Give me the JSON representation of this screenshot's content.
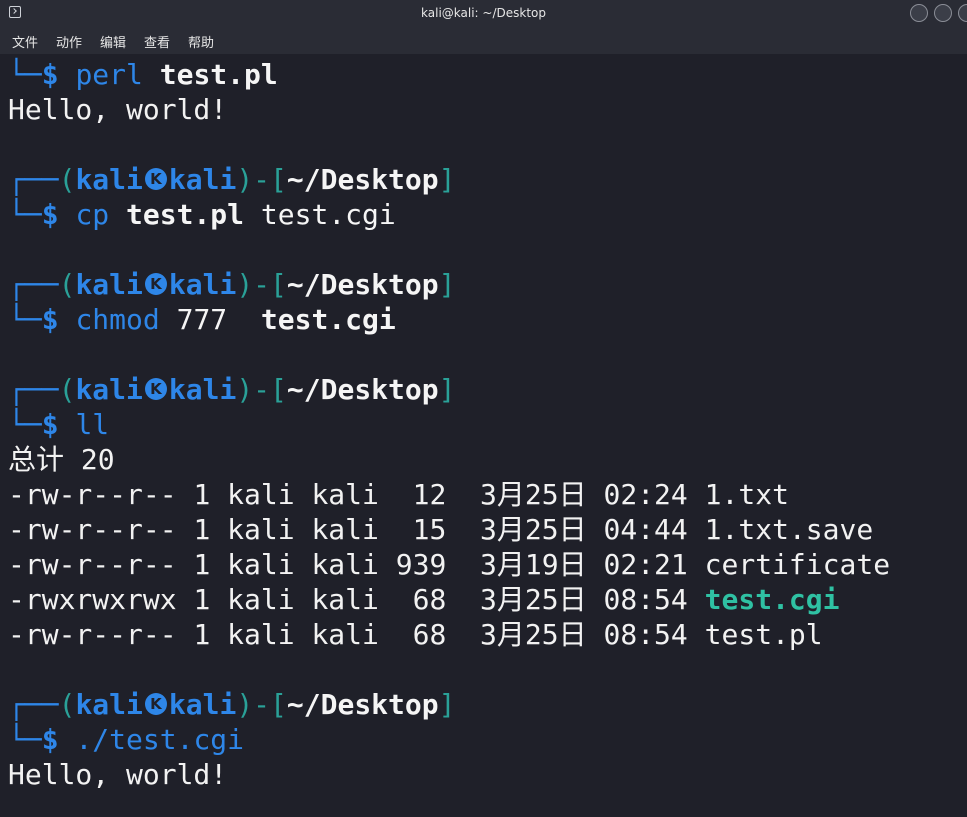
{
  "window": {
    "title": "kali@kali: ~/Desktop"
  },
  "menubar": {
    "items": [
      "文件",
      "动作",
      "编辑",
      "查看",
      "帮助"
    ]
  },
  "prompt": {
    "user": "kali",
    "host": "kali",
    "dir": "~/Desktop"
  },
  "terminal": {
    "cmd1": {
      "command": "perl",
      "arg": "test.pl"
    },
    "out1": "Hello, world!",
    "cmd2": {
      "command": "cp",
      "arg_bold": "test.pl",
      "arg": "test.cgi"
    },
    "cmd3": {
      "command": "chmod",
      "arg": "777",
      "arg_bold": "test.cgi"
    },
    "cmd4": {
      "command": "ll"
    },
    "total": "总计 20",
    "files": [
      {
        "perm": "-rw-r--r--",
        "links": "1",
        "owner": "kali",
        "group": "kali",
        "size": "12",
        "date": "3月25日",
        "time": "02:24",
        "name": "1.txt",
        "exec": false
      },
      {
        "perm": "-rw-r--r--",
        "links": "1",
        "owner": "kali",
        "group": "kali",
        "size": "15",
        "date": "3月25日",
        "time": "04:44",
        "name": "1.txt.save",
        "exec": false
      },
      {
        "perm": "-rw-r--r--",
        "links": "1",
        "owner": "kali",
        "group": "kali",
        "size": "939",
        "date": "3月19日",
        "time": "02:21",
        "name": "certificate",
        "exec": false
      },
      {
        "perm": "-rwxrwxrwx",
        "links": "1",
        "owner": "kali",
        "group": "kali",
        "size": "68",
        "date": "3月25日",
        "time": "08:54",
        "name": "test.cgi",
        "exec": true
      },
      {
        "perm": "-rw-r--r--",
        "links": "1",
        "owner": "kali",
        "group": "kali",
        "size": "68",
        "date": "3月25日",
        "time": "08:54",
        "name": "test.pl",
        "exec": false
      }
    ],
    "cmd5": {
      "command": "./test.cgi"
    },
    "out5": "Hello, world!"
  },
  "colors": {
    "background": "#1f2029",
    "prompt_blue": "#2e86e8",
    "bracket_cyan": "#2aa198",
    "exec_green": "#2fc1a3"
  }
}
